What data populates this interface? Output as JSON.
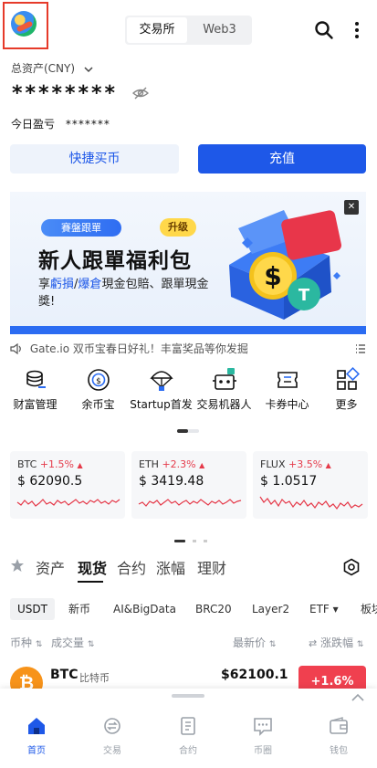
{
  "header": {
    "tabs": [
      {
        "label": "交易所",
        "active": true
      },
      {
        "label": "Web3",
        "active": false
      }
    ],
    "search_icon": "search-icon",
    "more_icon": "more-vertical-icon"
  },
  "assets": {
    "label": "总资产(CNY)",
    "masked_value": "********",
    "today_pnl_label": "今日盈亏",
    "today_pnl_value": "*******"
  },
  "actions": {
    "quick_buy": "快捷买币",
    "deposit": "充值"
  },
  "banner": {
    "tag": "賽盤跟單",
    "badge": "升级",
    "title": "新人跟單福利包",
    "subtitle_prefix": "享",
    "subtitle_loss": "虧損",
    "subtitle_sep": "/",
    "subtitle_liq": "爆倉",
    "subtitle_rest": "現金包賠、跟單現金獎!"
  },
  "notice": {
    "text": "Gate.io 双币宝春日好礼！丰富奖品等你发掘"
  },
  "quick_menu": [
    {
      "label": "财富管理",
      "icon": "coins-stack-icon"
    },
    {
      "label": "余币宝",
      "icon": "coin-dollar-icon"
    },
    {
      "label": "Startup首发",
      "icon": "parachute-icon"
    },
    {
      "label": "交易机器人",
      "icon": "robot-icon"
    },
    {
      "label": "卡券中心",
      "icon": "ticket-icon"
    },
    {
      "label": "更多",
      "icon": "grid-icon"
    }
  ],
  "tickers": [
    {
      "symbol": "BTC",
      "change": "+1.5%",
      "price": "$ 62090.5"
    },
    {
      "symbol": "ETH",
      "change": "+2.3%",
      "price": "$ 3419.48"
    },
    {
      "symbol": "FLUX",
      "change": "+3.5%",
      "price": "$ 1.0517"
    }
  ],
  "market_tabs": [
    {
      "label": "资产",
      "active": false
    },
    {
      "label": "现货",
      "active": true
    },
    {
      "label": "合约",
      "active": false
    },
    {
      "label": "涨幅",
      "active": false
    },
    {
      "label": "理财",
      "active": false
    }
  ],
  "chips": [
    {
      "label": "USDT",
      "active": true
    },
    {
      "label": "新币",
      "active": false
    },
    {
      "label": "AI&BigData",
      "active": false
    },
    {
      "label": "BRC20",
      "active": false
    },
    {
      "label": "Layer2",
      "active": false
    },
    {
      "label": "ETF ▾",
      "active": false
    },
    {
      "label": "板块",
      "active": false
    }
  ],
  "columns": {
    "coin": "币种",
    "volume": "成交量",
    "price": "最新价",
    "change": "涨跌幅"
  },
  "rows": [
    {
      "symbol": "BTC",
      "name": "比特币",
      "price": "$62100.1",
      "change": "+1.6%"
    }
  ],
  "bottom_nav": [
    {
      "label": "首页",
      "icon": "home-icon",
      "active": true
    },
    {
      "label": "交易",
      "icon": "trade-icon",
      "active": false
    },
    {
      "label": "合约",
      "icon": "contract-icon",
      "active": false
    },
    {
      "label": "币圈",
      "icon": "chat-icon",
      "active": false
    },
    {
      "label": "钱包",
      "icon": "wallet-icon",
      "active": false
    }
  ],
  "colors": {
    "accent": "#1e58e8",
    "up": "#e53a4a",
    "highlight_box": "#e63a2a"
  }
}
